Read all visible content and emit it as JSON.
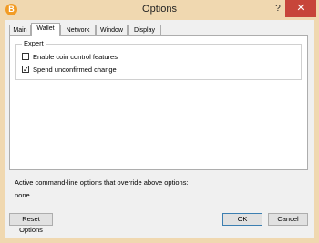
{
  "window": {
    "title": "Options",
    "app_icon_glyph": "B",
    "help_glyph": "?",
    "close_glyph": "✕"
  },
  "tabs": [
    {
      "label": "Main"
    },
    {
      "label": "Wallet"
    },
    {
      "label": "Network"
    },
    {
      "label": "Window"
    },
    {
      "label": "Display"
    }
  ],
  "active_tab": "Wallet",
  "expert": {
    "title": "Expert",
    "options": [
      {
        "label": "Enable coin control features",
        "checked": false
      },
      {
        "label": "Spend unconfirmed change",
        "checked": true
      }
    ]
  },
  "override": {
    "label": "Active command-line options that override above options:",
    "value": "none"
  },
  "buttons": {
    "reset": "Reset Options",
    "ok": "OK",
    "cancel": "Cancel"
  },
  "colors": {
    "titlebar": "#f0d8b0",
    "close": "#c7453a",
    "app_icon": "#f29c25"
  }
}
